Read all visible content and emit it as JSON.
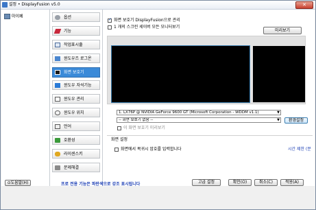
{
  "window": {
    "title": "설정 • DisplayFusion v5.0"
  },
  "col1": {
    "my_pc": "마이페"
  },
  "nav": {
    "items": [
      {
        "label": "옵션",
        "icon": "gear-icon"
      },
      {
        "label": "기능",
        "icon": "brush-icon"
      },
      {
        "label": "작업표시줄",
        "icon": "taskbar-icon"
      },
      {
        "label": "윈도우즈 로그온",
        "icon": "logon-icon"
      },
      {
        "label": "화면 보호기",
        "icon": "screensaver-icon"
      },
      {
        "label": "윈도우 자석기능",
        "icon": "magnet-icon"
      },
      {
        "label": "윈도우 관리",
        "icon": "window-icon"
      },
      {
        "label": "윈도우 위치",
        "icon": "position-icon"
      },
      {
        "label": "언어",
        "icon": "language-icon"
      },
      {
        "label": "호환성",
        "icon": "compat-icon"
      },
      {
        "label": "라이센스키",
        "icon": "key-icon"
      },
      {
        "label": "문제해결",
        "icon": "troubleshoot-icon"
      }
    ],
    "active_index": 4
  },
  "content": {
    "opt_manage": "화면 보호기 DisplayFusion으로 관리",
    "opt_each_monitor": "1 개의 스크린 세이버 모든 모니터보기",
    "preview_button": "미리보기",
    "monitor_select": "1. LX76P @ NVIDIA GeForce 9600 GT (Microsoft Corporation - WDDM v1.1)",
    "saver_select": "-- 화면 보호기 없음 --",
    "settings_button": "환경설정",
    "opt_preview_disabled": "이 화면 보호기 미리보기",
    "section_title": "화면 설정",
    "opt_password": "화면에서 복귀시 암호를 입력합니다",
    "wait_time": "시간 제한 (분"
  },
  "bottom": {
    "help_button": "도움말(H)",
    "promo": "프로 전용 기능은 파란색으로 강조 표시됩니다",
    "advanced_button": "고급 설정",
    "ok_button": "확인(O)",
    "cancel_button": "취소(C)",
    "apply_button": "적용(A)"
  }
}
